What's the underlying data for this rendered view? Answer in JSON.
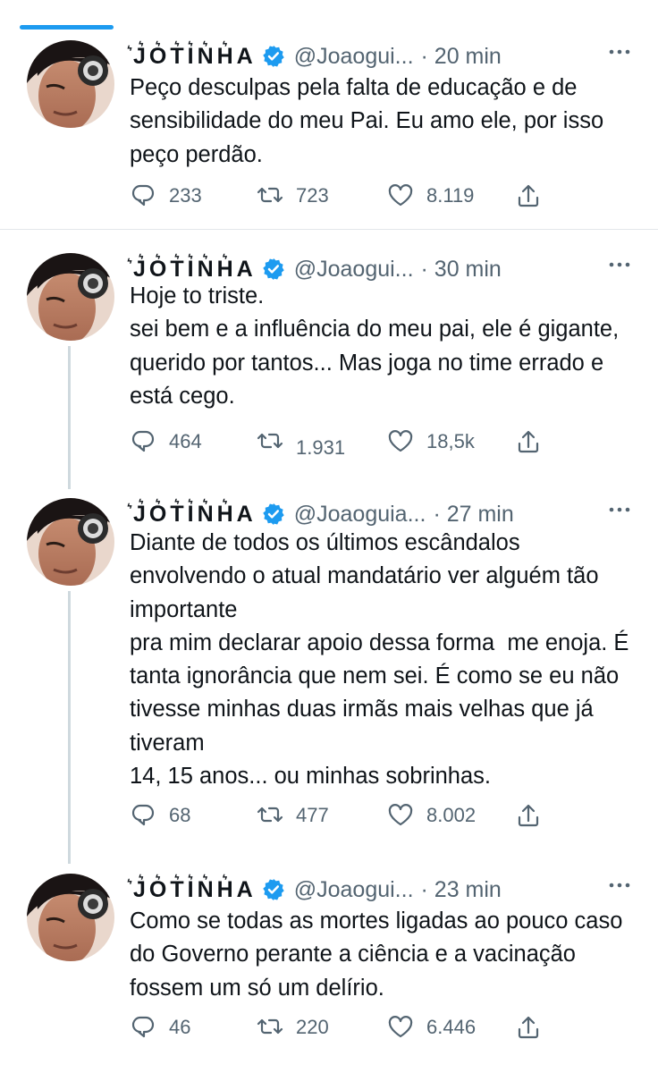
{
  "tweets": [
    {
      "name": "͛J͛O͛T͛I͛N͛H͛A",
      "handle": "@Joaogui...",
      "time": "· 20 min",
      "text": "Peço desculpas pela falta de educação e de sensibilidade do meu Pai. Eu amo ele, por isso peço perdão.",
      "replies": "233",
      "retweets": "723",
      "likes": "8.119"
    },
    {
      "name": "͛J͛O͛T͛I͛N͛H͛A",
      "handle": "@Joaogui...",
      "time": "· 30 min",
      "text": "Hoje to triste.\nsei bem e a influência do meu pai, ele é gigante, querido por tantos... Mas joga no time errado e está cego.",
      "replies": "464",
      "retweets": "1.931",
      "likes": "18,5k"
    },
    {
      "name": "͛J͛O͛T͛I͛N͛H͛A",
      "handle": "@Joaoguia...",
      "time": "· 27 min",
      "text": "Diante de todos os últimos escândalos envolvendo o atual mandatário ver alguém tão importante\npra mim declarar apoio dessa forma  me enoja. É tanta ignorância que nem sei. É como se eu não tivesse minhas duas irmãs mais velhas que já tiveram\n14, 15 anos... ou minhas sobrinhas.",
      "replies": "68",
      "retweets": "477",
      "likes": "8.002"
    },
    {
      "name": "͛J͛O͛T͛I͛N͛H͛A",
      "handle": "@Joaogui...",
      "time": "· 23 min",
      "text": "Como se todas as mortes ligadas ao pouco caso do Governo perante a ciência e a vacinação fossem um só um delírio.",
      "replies": "46",
      "retweets": "220",
      "likes": "6.446"
    }
  ],
  "colors": {
    "accent": "#1d9bf0",
    "text": "#0f1419",
    "secondary": "#536471",
    "thread_line": "#cfd9de",
    "divider": "#e3e7ea"
  },
  "icons": [
    "verified-badge-icon",
    "more-icon",
    "reply-icon",
    "retweet-icon",
    "like-icon",
    "share-icon"
  ]
}
